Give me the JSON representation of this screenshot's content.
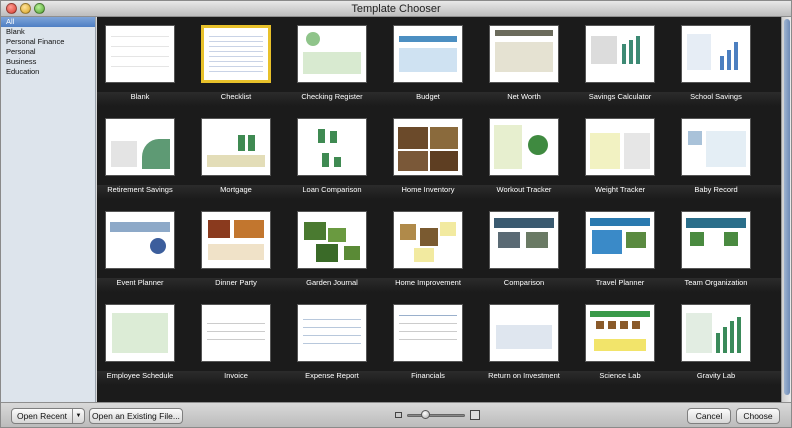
{
  "window": {
    "title": "Template Chooser"
  },
  "sidebar": {
    "items": [
      {
        "label": "All",
        "selected": true
      },
      {
        "label": "Blank",
        "selected": false
      },
      {
        "label": "Personal Finance",
        "selected": false
      },
      {
        "label": "Personal",
        "selected": false
      },
      {
        "label": "Business",
        "selected": false
      },
      {
        "label": "Education",
        "selected": false
      }
    ]
  },
  "templates": {
    "row1": [
      "Blank",
      "Checklist",
      "Checking Register",
      "Budget",
      "Net Worth",
      "Savings Calculator",
      "School Savings"
    ],
    "row2": [
      "Retirement Savings",
      "Mortgage",
      "Loan Comparison",
      "Home Inventory",
      "Workout Tracker",
      "Weight Tracker",
      "Baby Record"
    ],
    "row3": [
      "Event Planner",
      "Dinner Party",
      "Garden Journal",
      "Home Improvement",
      "Comparison",
      "Travel Planner",
      "Team Organization"
    ],
    "row4": [
      "Employee Schedule",
      "Invoice",
      "Expense Report",
      "Financials",
      "Return on Investment",
      "Science Lab",
      "Gravity Lab"
    ],
    "selected": "Checklist"
  },
  "toolbar": {
    "open_recent": "Open Recent",
    "open_existing": "Open an Existing File...",
    "cancel": "Cancel",
    "choose": "Choose"
  },
  "colors": {
    "selection": "#e8c12a",
    "grid_background": "#1b1b1b",
    "sidebar_selected": "#4f7fc4"
  }
}
